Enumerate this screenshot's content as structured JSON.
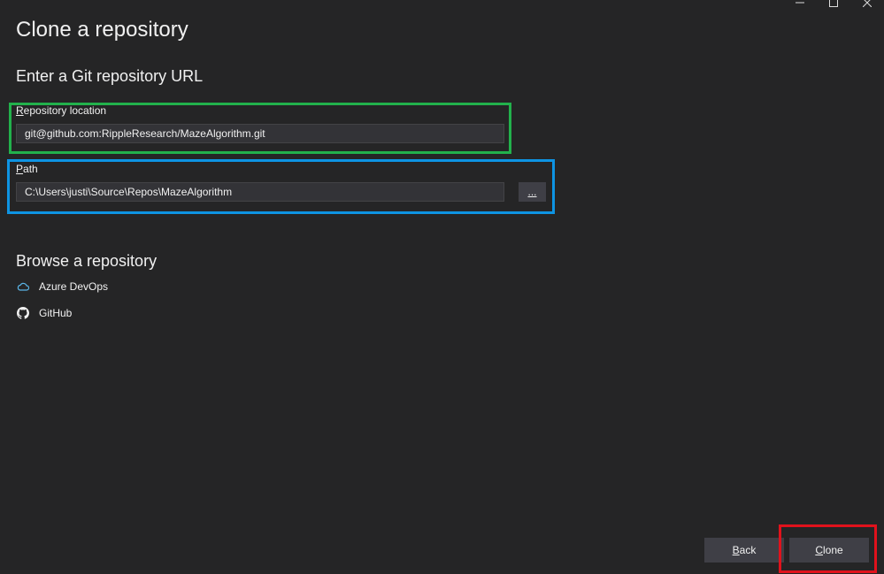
{
  "window": {
    "title": "Clone a repository"
  },
  "url_section": {
    "heading": "Enter a Git repository URL",
    "repo_label_accel": "R",
    "repo_label_rest": "epository location",
    "repo_value": "git@github.com:RippleResearch/MazeAlgorithm.git",
    "path_label_accel": "P",
    "path_label_rest": "ath",
    "path_value": "C:\\Users\\justi\\Source\\Repos\\MazeAlgorithm",
    "browse_label": "..."
  },
  "browse_section": {
    "heading": "Browse a repository",
    "items": [
      {
        "label": "Azure DevOps",
        "icon": "cloud-icon"
      },
      {
        "label": "GitHub",
        "icon": "github-icon"
      }
    ]
  },
  "footer": {
    "back_accel": "B",
    "back_rest": "ack",
    "clone_accel": "C",
    "clone_rest": "lone"
  },
  "highlights": {
    "repo_color": "#22b14c",
    "path_color": "#0e94e3",
    "clone_color": "#e0121c"
  },
  "colors": {
    "background": "#252526",
    "input_bg": "#333337",
    "button_bg": "#3f3f46",
    "azure_blue": "#5ab4e6"
  }
}
